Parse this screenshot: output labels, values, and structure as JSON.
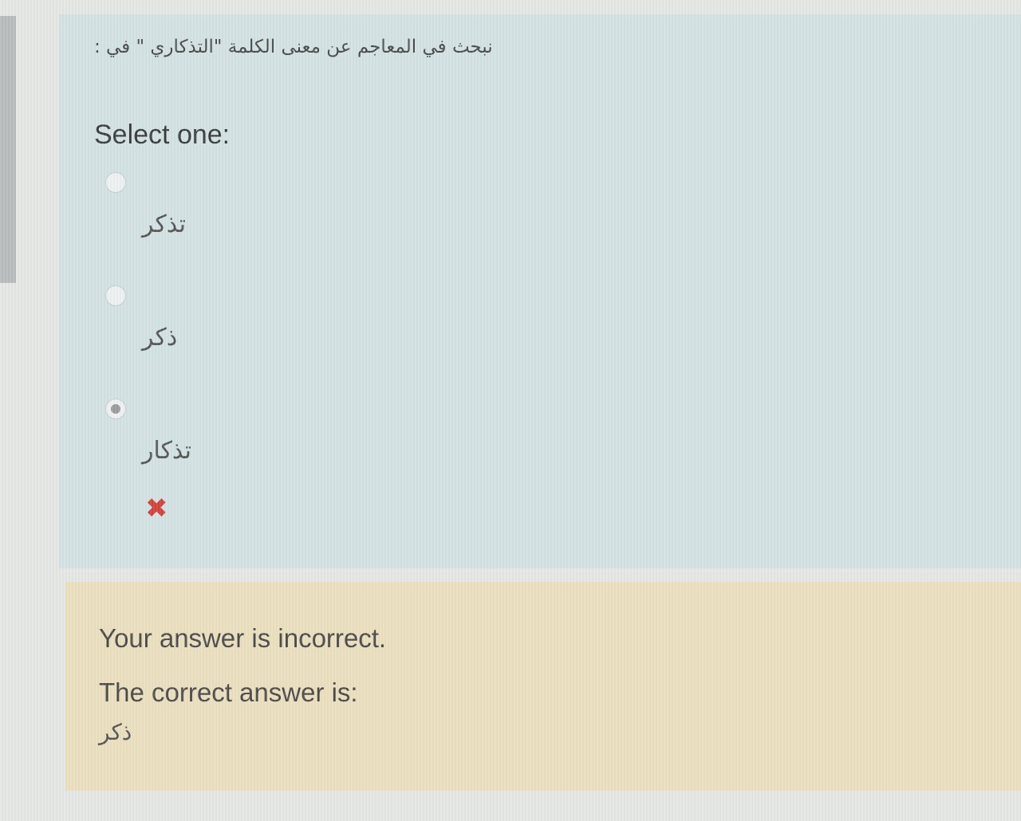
{
  "question": {
    "text": "نبحث في المعاجم عن معنى الكلمة \"التذكاري \" في :",
    "select_label": "Select one:",
    "options": [
      {
        "label": "تذكر",
        "checked": false
      },
      {
        "label": "ذكر",
        "checked": false
      },
      {
        "label": "تذكار",
        "checked": true
      }
    ],
    "incorrect_icon": "✖"
  },
  "feedback": {
    "incorrect": "Your answer is incorrect.",
    "correct_intro": "The correct answer is:",
    "correct_value": "ذكر"
  },
  "colors": {
    "question_panel": "#d2e2e3",
    "feedback_panel": "#eadfbe",
    "incorrect": "#d2423a"
  }
}
